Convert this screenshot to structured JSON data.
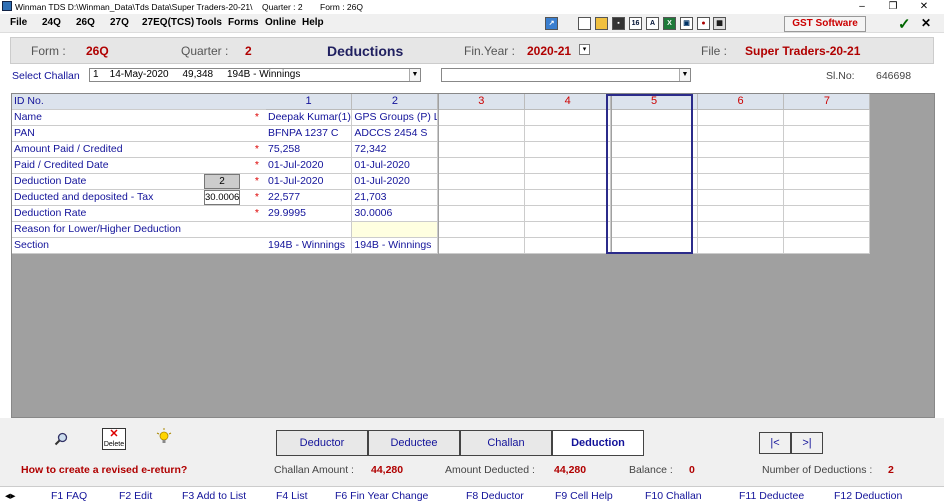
{
  "window": {
    "title": "Winman TDS D:\\Winman_Data\\Tds Data\\Super Traders-20-21\\",
    "quarter_text": "Quarter : 2",
    "form_text": "Form : 26Q",
    "minimize": "–",
    "restore": "❐",
    "close": "✕"
  },
  "menu": [
    "File",
    "24Q",
    "26Q",
    "27Q",
    "27EQ(TCS)",
    "Tools",
    "Forms",
    "Online",
    "Help"
  ],
  "toolbar": {
    "gst_label": "GST Software",
    "ok_symbol": "✓",
    "close_symbol": "✕",
    "icons": [
      "upload-icon",
      "new-file-icon",
      "open-folder-icon",
      "save-icon",
      "form16-icon",
      "form16a-icon",
      "excel-icon",
      "lock-icon",
      "user-settings-icon",
      "calculator-icon"
    ]
  },
  "header": {
    "form_label": "Form :",
    "form_value": "26Q",
    "quarter_label": "Quarter :",
    "quarter_value": "2",
    "title": "Deductions",
    "finyear_label": "Fin.Year :",
    "finyear_value": "2020-21",
    "file_label": "File :",
    "file_value": "Super Traders-20-21"
  },
  "challan": {
    "label": "Select Challan",
    "selected": "1    14-May-2020     49,348     194B - Winnings",
    "second_value": "",
    "slno_label": "Sl.No:",
    "slno_value": "646698"
  },
  "grid": {
    "row_labels": [
      "ID No.",
      "Name",
      "PAN",
      "Amount Paid / Credited",
      "Paid / Credited Date",
      "Deduction Date",
      "Deducted and deposited - Tax",
      "Deduction Rate",
      "Reason for Lower/Higher Deduction",
      "Section"
    ],
    "required": [
      "",
      "*",
      "",
      "*",
      "*",
      "*",
      "*",
      "*",
      "",
      ""
    ],
    "deduction_date_box": "2",
    "tax_rate_box": "30.0006",
    "columns": [
      "1",
      "2",
      "3",
      "4",
      "5",
      "6",
      "7"
    ],
    "cells": [
      [
        "Deepak Kumar(1)",
        "BFNPA 1237 C",
        "75,258",
        "01-Jul-2020",
        "01-Jul-2020",
        "22,577",
        "29.9995",
        "",
        "194B - Winnings"
      ],
      [
        "GPS Groups (P) L",
        "ADCCS 2454 S",
        "72,342",
        "01-Jul-2020",
        "01-Jul-2020",
        "21,703",
        "30.0006",
        "",
        "194B - Winnings"
      ],
      [
        "",
        "",
        "",
        "",
        "",
        "",
        "",
        "",
        ""
      ],
      [
        "",
        "",
        "",
        "",
        "",
        "",
        "",
        "",
        ""
      ],
      [
        "",
        "",
        "",
        "",
        "",
        "",
        "",
        "",
        ""
      ],
      [
        "",
        "",
        "",
        "",
        "",
        "",
        "",
        "",
        ""
      ],
      [
        "",
        "",
        "",
        "",
        "",
        "",
        "",
        "",
        ""
      ]
    ]
  },
  "bottom": {
    "delete_label": "Delete",
    "tabs": [
      "Deductor",
      "Deductee",
      "Challan",
      "Deduction"
    ],
    "nav_first": "|<",
    "nav_last": ">|",
    "help_link": "How to create a revised e-return?",
    "challan_amount_label": "Challan Amount :",
    "challan_amount": "44,280",
    "amount_deducted_label": "Amount Deducted :",
    "amount_deducted": "44,280",
    "balance_label": "Balance :",
    "balance": "0",
    "num_deductions_label": "Number of Deductions :",
    "num_deductions": "2"
  },
  "fkeys": [
    "F1  FAQ",
    "F2  Edit",
    "F3  Add to List",
    "F4  List",
    "F6  Fin Year Change",
    "F8  Deductor",
    "F9  Cell Help",
    "F10  Challan",
    "F11  Deductee",
    "F12  Deduction"
  ],
  "colors": {
    "accent_red": "#b00000",
    "text_blue": "#13139a",
    "grid_gray": "#a0a0a0"
  }
}
